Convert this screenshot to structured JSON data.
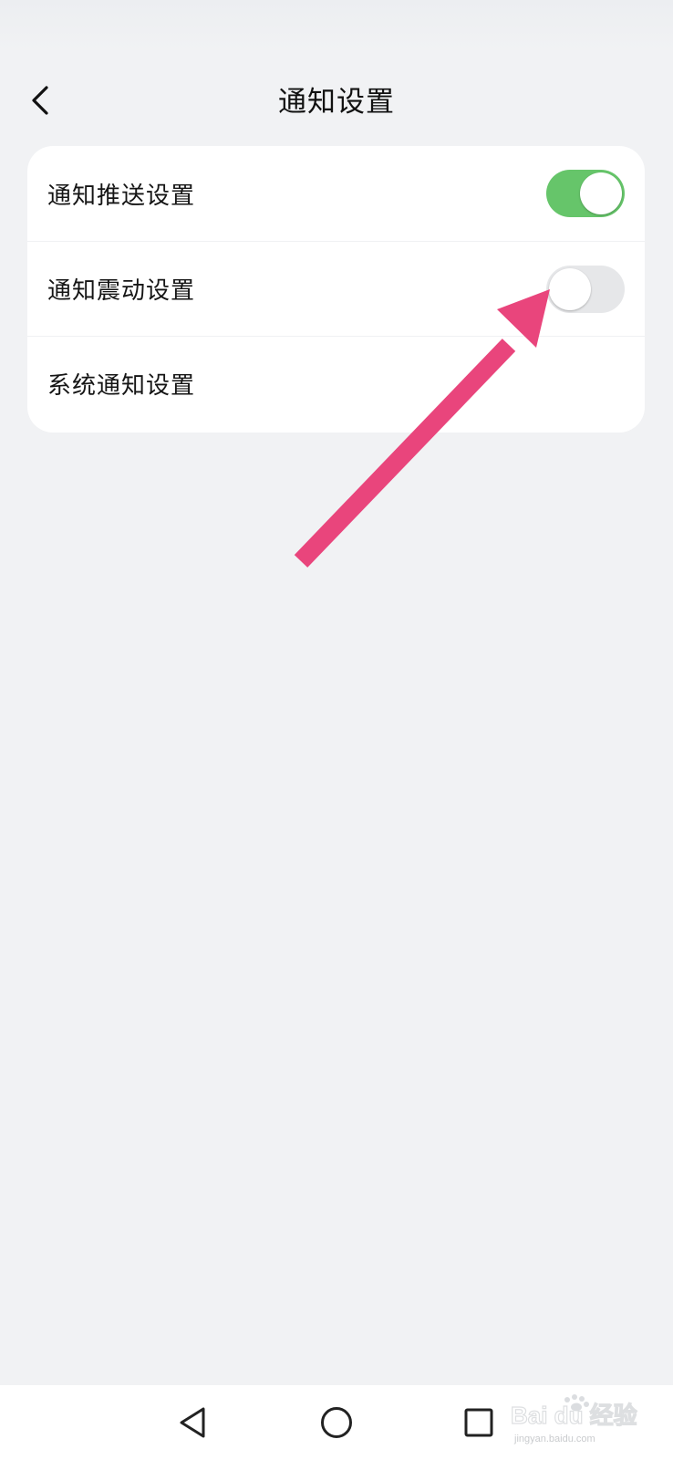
{
  "header": {
    "title": "通知设置",
    "back_icon": "chevron-left-icon"
  },
  "settings": [
    {
      "label": "通知推送设置",
      "toggle": "on"
    },
    {
      "label": "通知震动设置",
      "toggle": "off"
    },
    {
      "label": "系统通知设置"
    }
  ],
  "colors": {
    "background": "#f1f2f4",
    "card": "#ffffff",
    "toggle_on": "#66c56a",
    "toggle_off": "#e6e7e9",
    "annotation_arrow": "#e9457c"
  },
  "nav_bar": {
    "icons": [
      "back-triangle-icon",
      "home-circle-icon",
      "recents-square-icon"
    ]
  },
  "watermark": {
    "text": "Bai du 经验",
    "subtext": "jingyan.baidu.com"
  }
}
